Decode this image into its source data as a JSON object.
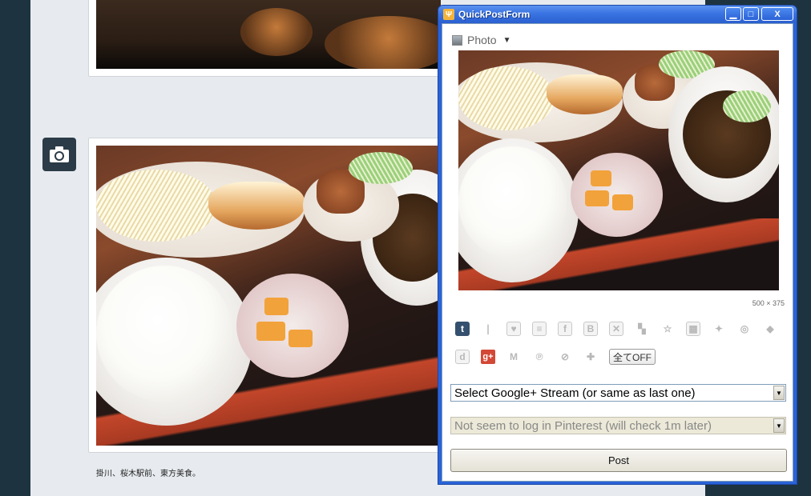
{
  "window": {
    "title": "QuickPostForm",
    "minimize_glyph": "▁",
    "maximize_glyph": "□",
    "close_glyph": "X"
  },
  "form": {
    "post_type": "Photo",
    "post_type_caret": "▼",
    "image_dimensions": "500 × 375",
    "services_row1": [
      "tumblr-icon",
      "readability-icon",
      "instapaper-icon",
      "evernote-icon",
      "facebook-icon",
      "hatena-bookmark-icon",
      "pinboard-icon",
      "delicious-icon",
      "star-icon",
      "diigo-icon",
      "twitter-icon",
      "plurk-icon",
      "foursquare-icon"
    ],
    "services_row2": [
      "dropmark-icon",
      "google-plus-icon",
      "gmail-icon",
      "pinterest-icon",
      "disabled-service-icon",
      "add-service-icon"
    ],
    "service_labels": {
      "tumblr": "t",
      "gplus": "g+"
    },
    "all_off_label": "全てOFF",
    "google_stream_select": "Select Google+ Stream (or same as last one)",
    "pinterest_select": "Not seem to log in Pinterest (will check 1m later)",
    "post_button": "Post"
  },
  "background": {
    "caption": "掛川、桜木駅前、東方美食。",
    "post_type_icon": "camera-icon"
  },
  "colors": {
    "titlebar": "#3a74e2",
    "desktop": "#1d3440",
    "dashboard": "#e7ebef"
  }
}
